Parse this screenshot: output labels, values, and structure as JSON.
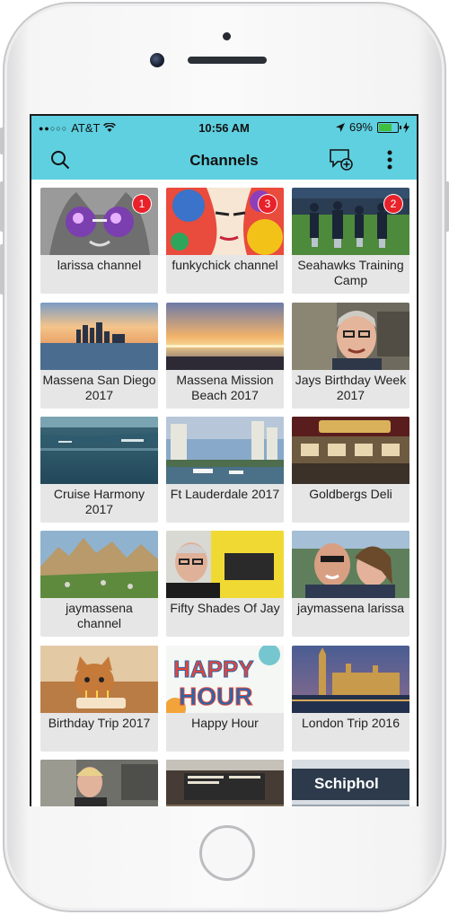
{
  "status_bar": {
    "signal": "●●○○○",
    "carrier": "AT&T",
    "time": "10:56 AM",
    "battery_percent": "69%",
    "battery_level": 0.69
  },
  "header": {
    "title": "Channels",
    "icons": [
      "search-icon",
      "new-message-icon",
      "more-vertical-icon"
    ]
  },
  "channels": [
    {
      "label": "larissa channel",
      "badge": "1"
    },
    {
      "label": "funkychick channel",
      "badge": "3"
    },
    {
      "label": "Seahawks Training Camp",
      "badge": "2"
    },
    {
      "label": "Massena San Diego 2017",
      "badge": ""
    },
    {
      "label": "Massena Mission Beach 2017",
      "badge": ""
    },
    {
      "label": "Jays Birthday Week 2017",
      "badge": ""
    },
    {
      "label": "Cruise Harmony 2017",
      "badge": ""
    },
    {
      "label": "Ft Lauderdale 2017",
      "badge": ""
    },
    {
      "label": "Goldbergs Deli",
      "badge": ""
    },
    {
      "label": "jaymassena channel",
      "badge": ""
    },
    {
      "label": "Fifty Shades Of Jay",
      "badge": ""
    },
    {
      "label": "jaymassena larissa",
      "badge": ""
    },
    {
      "label": "Birthday Trip 2017",
      "badge": ""
    },
    {
      "label": "Happy Hour",
      "badge": ""
    },
    {
      "label": "London Trip 2016",
      "badge": ""
    },
    {
      "label": "",
      "badge": ""
    },
    {
      "label": "",
      "badge": ""
    },
    {
      "label": "",
      "badge": ""
    }
  ],
  "colors": {
    "accent": "#5fd0e0",
    "badge": "#e8212a"
  }
}
